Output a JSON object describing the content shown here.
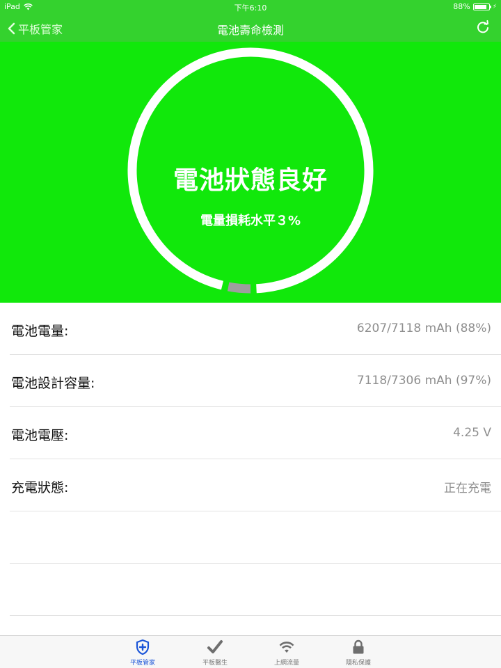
{
  "status_bar": {
    "device": "iPad",
    "time": "下午6:10",
    "battery_percent": "88%",
    "battery_level": 0.88,
    "icons": [
      "wifi-icon",
      "battery-icon",
      "charging-bolt-icon"
    ]
  },
  "nav": {
    "back_label": "平板管家",
    "title": "電池壽命檢測",
    "icons": [
      "chevron-left-icon",
      "refresh-icon"
    ]
  },
  "hero": {
    "headline": "電池狀態良好",
    "subline": "電量損耗水平３%",
    "wear_fraction": 0.03,
    "colors": {
      "background": "#11e80b",
      "ring": "#ffffff",
      "ring_gap": "#9e9e9e"
    }
  },
  "details": [
    {
      "label": "電池電量:",
      "value": "6207/7118 mAh (88%)"
    },
    {
      "label": "電池設計容量:",
      "value": "7118/7306 mAh (97%)"
    },
    {
      "label": "電池電壓:",
      "value": "4.25 V"
    },
    {
      "label": "充電狀態:",
      "value": "正在充電"
    },
    {
      "label": "",
      "value": ""
    },
    {
      "label": "",
      "value": ""
    }
  ],
  "tabbar": {
    "active_color": "#1a54d8",
    "tabs": [
      {
        "label": "平板管家",
        "icon": "shield-plus-icon",
        "active": true
      },
      {
        "label": "平板醫生",
        "icon": "checkmark-icon",
        "active": false
      },
      {
        "label": "上網流量",
        "icon": "wifi-icon",
        "active": false
      },
      {
        "label": "隱私保護",
        "icon": "lock-icon",
        "active": false
      }
    ]
  },
  "colors": {
    "header_green": "#34d22e"
  }
}
